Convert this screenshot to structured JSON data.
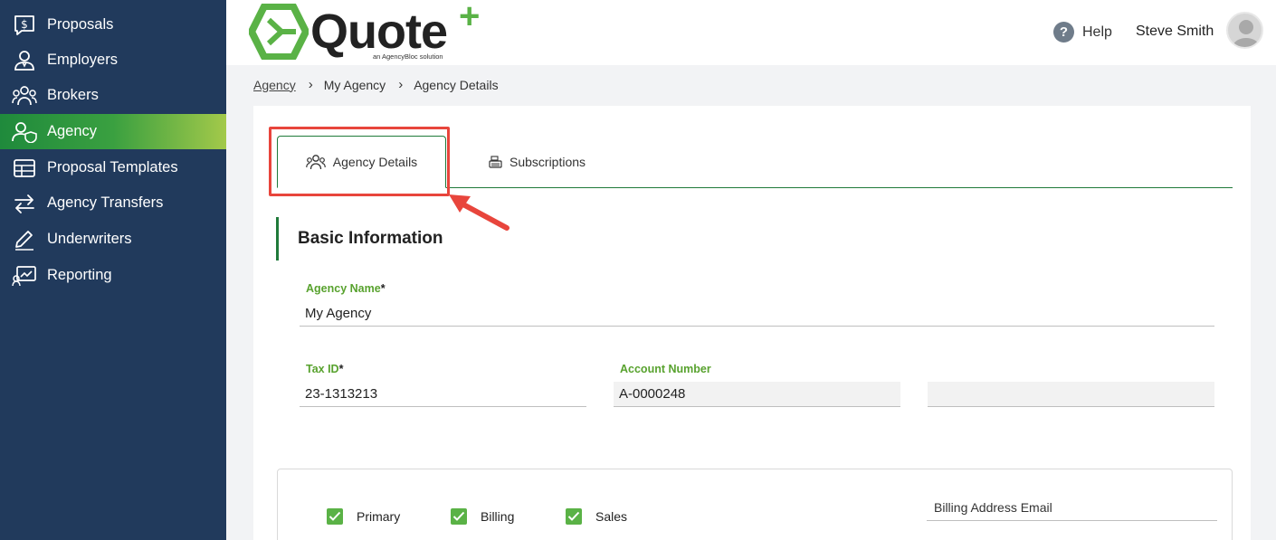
{
  "sidebar": {
    "items": [
      {
        "label": "Proposals",
        "icon": "dollar-chat-icon",
        "active": false
      },
      {
        "label": "Employers",
        "icon": "employers-icon",
        "active": false
      },
      {
        "label": "Brokers",
        "icon": "brokers-icon",
        "active": false
      },
      {
        "label": "Agency",
        "icon": "agency-shield-user-icon",
        "active": true
      },
      {
        "label": "Proposal Templates",
        "icon": "table-icon",
        "active": false
      },
      {
        "label": "Agency Transfers",
        "icon": "transfer-arrows-icon",
        "active": false
      },
      {
        "label": "Underwriters",
        "icon": "pencil-icon",
        "active": false
      },
      {
        "label": "Reporting",
        "icon": "reporting-chart-icon",
        "active": false
      }
    ]
  },
  "header": {
    "logo_word": "Quote",
    "logo_plus": "+",
    "logo_tagline": "an AgencyBloc solution",
    "help_label": "Help",
    "user_name": "Steve Smith"
  },
  "breadcrumb": {
    "items": [
      "Agency",
      "My Agency",
      "Agency Details"
    ],
    "separator": "›"
  },
  "tabs": [
    {
      "label": "Agency Details",
      "icon": "users-icon",
      "active": true
    },
    {
      "label": "Subscriptions",
      "icon": "register-icon",
      "active": false
    }
  ],
  "section": {
    "title": "Basic Information"
  },
  "fields": {
    "agency_name": {
      "label": "Agency Name",
      "required_mark": "*",
      "value": "My Agency"
    },
    "tax_id": {
      "label": "Tax ID",
      "required_mark": "*",
      "value": "23-1313213"
    },
    "account_number": {
      "label": "Account Number",
      "value": "A-0000248"
    },
    "extra": {
      "value": ""
    }
  },
  "address": {
    "checkboxes": [
      {
        "label": "Primary",
        "checked": true
      },
      {
        "label": "Billing",
        "checked": true
      },
      {
        "label": "Sales",
        "checked": true
      }
    ],
    "billing_email_placeholder": "Billing Address Email"
  },
  "colors": {
    "sidebar_bg": "#213a5c",
    "accent_green": "#1f7a3a",
    "label_green": "#58a22e",
    "highlight_red": "#e8453c"
  }
}
